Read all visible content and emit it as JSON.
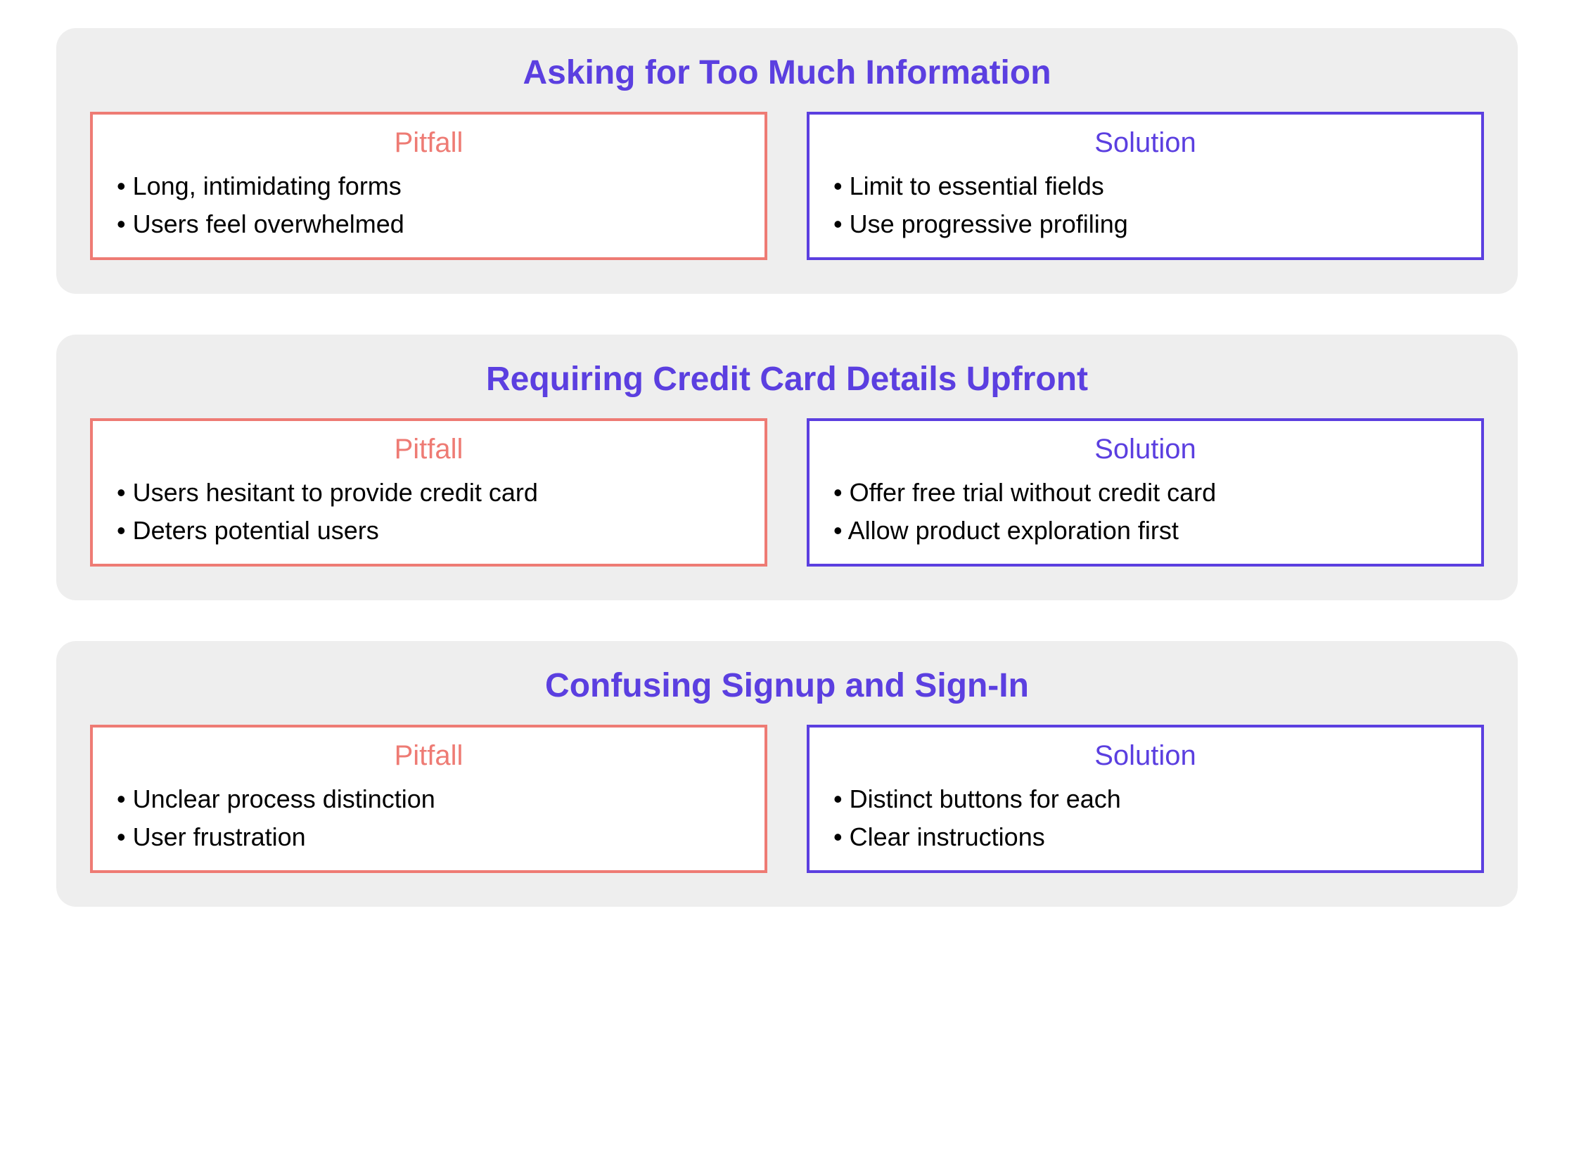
{
  "labels": {
    "pitfall": "Pitfall",
    "solution": "Solution"
  },
  "sections": [
    {
      "title": "Asking for Too Much Information",
      "pitfall": [
        "Long, intimidating forms",
        "Users feel overwhelmed"
      ],
      "solution": [
        "Limit to essential fields",
        "Use progressive profiling"
      ]
    },
    {
      "title": "Requiring Credit Card Details Upfront",
      "pitfall": [
        "Users hesitant to provide credit card",
        "Deters potential users"
      ],
      "solution": [
        "Offer free trial without credit card",
        "Allow product exploration first"
      ]
    },
    {
      "title": "Confusing Signup and Sign-In",
      "pitfall": [
        "Unclear process distinction",
        "User frustration"
      ],
      "solution": [
        "Distinct buttons for each",
        "Clear instructions"
      ]
    }
  ]
}
